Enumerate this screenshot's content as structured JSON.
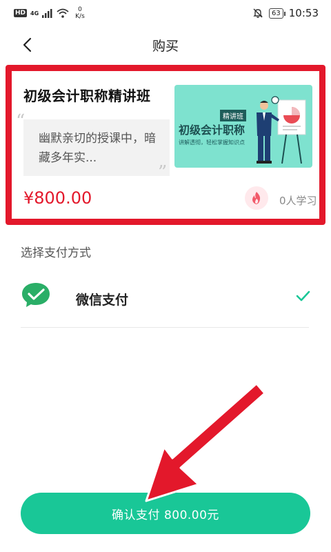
{
  "status_bar": {
    "hd": "HD",
    "network": "4G",
    "speed_value": "0",
    "speed_unit": "K/s",
    "battery": "63",
    "time": "10:53"
  },
  "header": {
    "title": "购买"
  },
  "course": {
    "title": "初级会计职称精讲班",
    "description": "幽默亲切的授课中，暗藏多年实...",
    "price": "¥800.00",
    "learners": "0人学习",
    "thumbnail": {
      "badge": "精讲班",
      "title": "初级会计职称",
      "subtitle": "讲解透彻，轻松掌握知识点"
    }
  },
  "payment": {
    "header": "选择支付方式",
    "method": "微信支付",
    "icon": "wechat-pay-icon"
  },
  "confirm": {
    "label": "确认支付 800.00元"
  },
  "colors": {
    "accent": "#19c797",
    "price": "#e3182b",
    "annotation": "#e3182b"
  }
}
